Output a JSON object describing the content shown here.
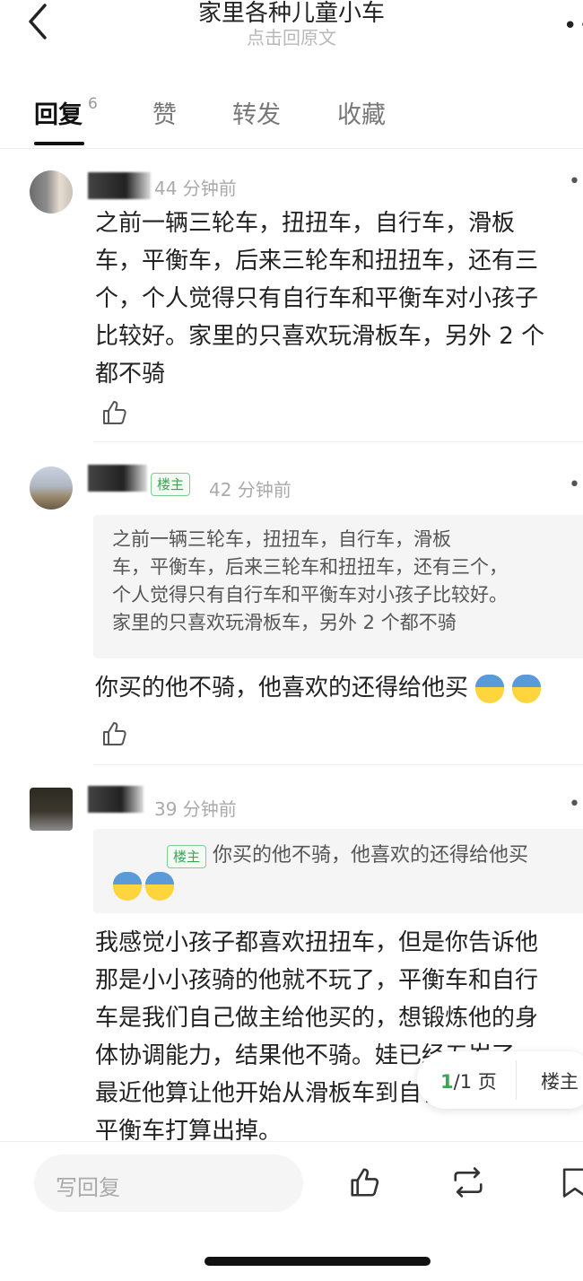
{
  "header": {
    "title": "家里各种儿童小车",
    "subtitle": "点击回原文",
    "more": "••"
  },
  "tabs": [
    {
      "label": "回复",
      "count": "6"
    },
    {
      "label": "赞"
    },
    {
      "label": "转发"
    },
    {
      "label": "收藏"
    }
  ],
  "comments": [
    {
      "time": "44 分钟前",
      "text": "之前一辆三轮车，扭扭车，自行车，滑板\n车，平衡车，后来三轮车和扭扭车，还有三\n个，个人觉得只有自行车和平衡车对小孩子\n比较好。家里的只喜欢玩滑板车，另外 2 个\n都不骑"
    },
    {
      "badge": "楼主",
      "time": "42 分钟前",
      "quote": "之前一辆三轮车，扭扭车，自行车，滑板\n车，平衡车，后来三轮车和扭扭车，还有三个，\n个人觉得只有自行车和平衡车对小孩子比较好。\n家里的只喜欢玩滑板车，另外 2 个都不骑",
      "text": "你买的他不骑，他喜欢的还得给他买"
    },
    {
      "time": "39 分钟前",
      "quote_badge": "楼主",
      "quote": "你买的他不骑，他喜欢的还得给他买",
      "text": "我感觉小孩子都喜欢扭扭车，但是你告诉他\n那是小小孩骑的他就不玩了，平衡车和自行\n车是我们自己做主给他买的，想锻炼他的身\n体协调能力，结果他不骑。娃已经五岁了，\n最近他算让他开始从滑板车到自行车过渡，\n平衡车打算出掉。"
    }
  ],
  "pager": {
    "current": "1",
    "total_label": "/1 页",
    "op_label": "楼主"
  },
  "bottom": {
    "reply_placeholder": "写回复"
  },
  "colors": {
    "accent_green": "#3aa655"
  }
}
